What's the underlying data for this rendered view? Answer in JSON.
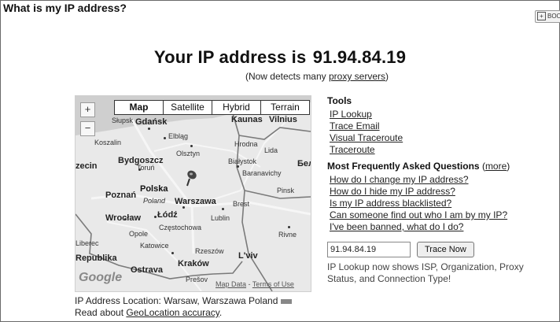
{
  "window": {
    "title": "What is my IP address?"
  },
  "bookmark": {
    "label": "BOOKMARK"
  },
  "headline": {
    "prefix": "Your IP address is",
    "ip": "91.94.84.19"
  },
  "subline": {
    "before": "(Now detects many ",
    "link": "proxy servers",
    "after": ")"
  },
  "map": {
    "zoom_in": "+",
    "zoom_out": "−",
    "types": [
      "Map",
      "Satellite",
      "Hybrid",
      "Terrain"
    ],
    "active_type": "Map",
    "country_label": "Polska",
    "country_sub": "Poland",
    "cities": [
      "Słupsk",
      "Gdańsk",
      "Kaunas",
      "Vilnius",
      "Koszalin",
      "Elbląg",
      "Olsztyn",
      "Hrodna",
      "Lida",
      "Bydgoszcz",
      "Białystok",
      "Baranavichy",
      "zecin",
      "Toruń",
      "Бел",
      "Poznań",
      "Pinsk",
      "Warszawa",
      "Brest",
      "Wrocław",
      "Łódź",
      "Lublin",
      "Częstochowa",
      "Opole",
      "Katowice",
      "Rzeszów",
      "Rivne",
      "Liberec",
      "Kraków",
      "L'viv",
      "Republika",
      "Ostrava",
      "Prešov"
    ],
    "logo": "Google",
    "footer_data": "Map Data",
    "footer_terms": "Terms of Use"
  },
  "location": {
    "label": "IP Address Location:",
    "value": "Warsaw, Warszawa Poland"
  },
  "geo": {
    "before": "Read about ",
    "link": "GeoLocation accuracy",
    "after": "."
  },
  "tools": {
    "title": "Tools",
    "items": [
      "IP Lookup",
      "Trace Email",
      "Visual Traceroute",
      "Traceroute"
    ]
  },
  "faq": {
    "title": "Most Frequently Asked Questions",
    "more": "more",
    "items": [
      "How do I change my IP address?",
      "How do I hide my IP address?",
      "Is my IP address blacklisted?",
      "Can someone find out who I am by my IP?",
      "I've been banned, what do I do?"
    ]
  },
  "trace": {
    "input_value": "91.94.84.19",
    "button": "Trace Now"
  },
  "info": "IP Lookup now shows ISP, Organization, Proxy Status, and Connection Type!"
}
